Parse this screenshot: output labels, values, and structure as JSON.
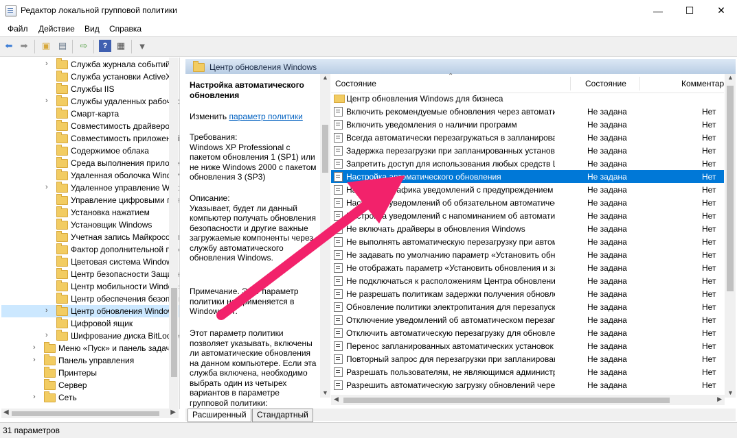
{
  "window": {
    "title": "Редактор локальной групповой политики",
    "minimize": "—",
    "maximize": "☐",
    "close": "✕"
  },
  "menu": [
    "Файл",
    "Действие",
    "Вид",
    "Справка"
  ],
  "toolbar_icons": [
    "back-icon",
    "forward-icon",
    "up-folder-icon",
    "show-hide-tree-icon",
    "export-list-icon",
    "help-icon",
    "properties-icon",
    "filter-icon"
  ],
  "tree": {
    "items": [
      {
        "label": "Служба журнала событий",
        "arrow": true
      },
      {
        "label": "Служба установки ActiveX",
        "arrow": false
      },
      {
        "label": "Службы IIS",
        "arrow": false
      },
      {
        "label": "Службы удаленных рабочих",
        "arrow": true
      },
      {
        "label": "Смарт-карта",
        "arrow": false
      },
      {
        "label": "Совместимость драйверов",
        "arrow": false
      },
      {
        "label": "Совместимость приложений",
        "arrow": false
      },
      {
        "label": "Содержимое облака",
        "arrow": false
      },
      {
        "label": "Среда выполнения приложений",
        "arrow": false
      },
      {
        "label": "Удаленная оболочка Windows",
        "arrow": false
      },
      {
        "label": "Удаленное управление Windows",
        "arrow": true
      },
      {
        "label": "Управление цифровыми правами",
        "arrow": false
      },
      {
        "label": "Установка нажатием",
        "arrow": false
      },
      {
        "label": "Установщик Windows",
        "arrow": false
      },
      {
        "label": "Учетная запись Майкрософт",
        "arrow": false
      },
      {
        "label": "Фактор дополнительной проверки",
        "arrow": false
      },
      {
        "label": "Цветовая система Windows",
        "arrow": false
      },
      {
        "label": "Центр безопасности Защитника",
        "arrow": false
      },
      {
        "label": "Центр мобильности Windows",
        "arrow": false
      },
      {
        "label": "Центр обеспечения безопасности",
        "arrow": false
      },
      {
        "label": "Центр обновления Windows",
        "arrow": true,
        "selected": true
      },
      {
        "label": "Цифровой ящик",
        "arrow": false
      },
      {
        "label": "Шифрование диска BitLocker",
        "arrow": true
      }
    ],
    "top_items": [
      {
        "label": "Меню «Пуск» и панель задач",
        "arrow": true
      },
      {
        "label": "Панель управления",
        "arrow": true
      },
      {
        "label": "Принтеры",
        "arrow": false
      },
      {
        "label": "Сервер",
        "arrow": false
      },
      {
        "label": "Сеть",
        "arrow": true
      }
    ]
  },
  "right_pane": {
    "title": "Центр обновления Windows",
    "desc": {
      "title": "Настройка автоматического обновления",
      "edit_prefix": "Изменить",
      "edit_link": "параметр политики",
      "requirements": "Требования:\nWindows XP Professional с пакетом обновления 1 (SP1) или не ниже Windows 2000 с пакетом обновления 3 (SP3)",
      "description": "Описание:\nУказывает, будет ли данный компьютер получать обновления безопасности и другие важные загружаемые компоненты через службу автоматического обновления Windows.",
      "note": "Примечание. Этот параметр политики не применяется в Windows RT.",
      "extra": "Этот параметр политики позволяет указывать, включены ли автоматические обновления на данном компьютере. Если эта служба включена, необходимо выбрать один из четырех вариантов в параметре групповой политики:"
    },
    "columns": {
      "c1": "Состояние",
      "c2": "Состояние",
      "c3": "Комментар"
    },
    "rows": [
      {
        "name": "Центр обновления Windows для бизнеса",
        "state": "",
        "comment": "",
        "folder": true
      },
      {
        "name": "Включить рекомендуемые обновления через автоматич...",
        "state": "Не задана",
        "comment": "Нет"
      },
      {
        "name": "Включить уведомления о наличии программ",
        "state": "Не задана",
        "comment": "Нет"
      },
      {
        "name": "Всегда автоматически перезагружаться в запланированн...",
        "state": "Не задана",
        "comment": "Нет"
      },
      {
        "name": "Задержка перезагрузки при запланированных установках",
        "state": "Не задана",
        "comment": "Нет"
      },
      {
        "name": "Запретить доступ для использования любых средств Цен...",
        "state": "Не задана",
        "comment": "Нет"
      },
      {
        "name": "Настройка автоматического обновления",
        "state": "Не задана",
        "comment": "Нет",
        "selected": true
      },
      {
        "name": "Настройка графика уведомлений с предупреждением об ...",
        "state": "Не задана",
        "comment": "Нет"
      },
      {
        "name": "Настройка уведомлений об обязательном автоматическ...",
        "state": "Не задана",
        "comment": "Нет"
      },
      {
        "name": "Настройка уведомлений с напоминанием об автоматич...",
        "state": "Не задана",
        "comment": "Нет"
      },
      {
        "name": "Не включать драйверы в обновления Windows",
        "state": "Не задана",
        "comment": "Нет"
      },
      {
        "name": "Не выполнять автоматическую перезагрузку при автома...",
        "state": "Не задана",
        "comment": "Нет"
      },
      {
        "name": "Не задавать по умолчанию параметр «Установить обнов...",
        "state": "Не задана",
        "comment": "Нет"
      },
      {
        "name": "Не отображать параметр «Установить обновления и заве...",
        "state": "Не задана",
        "comment": "Нет"
      },
      {
        "name": "Не подключаться к расположениям Центра обновления ...",
        "state": "Не задана",
        "comment": "Нет"
      },
      {
        "name": "Не разрешать политикам задержки получения обновлени...",
        "state": "Не задана",
        "comment": "Нет"
      },
      {
        "name": "Обновление политики электропитания для перезапуска ...",
        "state": "Не задана",
        "comment": "Нет"
      },
      {
        "name": "Отключение уведомлений об автоматическом перезапу...",
        "state": "Не задана",
        "comment": "Нет"
      },
      {
        "name": "Отключить автоматическую перезагрузку для обновлени...",
        "state": "Не задана",
        "comment": "Нет"
      },
      {
        "name": "Перенос запланированных автоматических установок об...",
        "state": "Не задана",
        "comment": "Нет"
      },
      {
        "name": "Повторный запрос для перезагрузки при запланированн...",
        "state": "Не задана",
        "comment": "Нет"
      },
      {
        "name": "Разрешать пользователям, не являющимся администрат...",
        "state": "Не задана",
        "comment": "Нет"
      },
      {
        "name": "Разрешить автоматическую загрузку обновлений через ...",
        "state": "Не задана",
        "comment": "Нет"
      }
    ]
  },
  "tabs": [
    "Расширенный",
    "Стандартный"
  ],
  "status": "31 параметров",
  "colors": {
    "selection": "#0078d7",
    "tree_selection": "#cce8ff",
    "annotation_arrow": "#f2226b"
  }
}
